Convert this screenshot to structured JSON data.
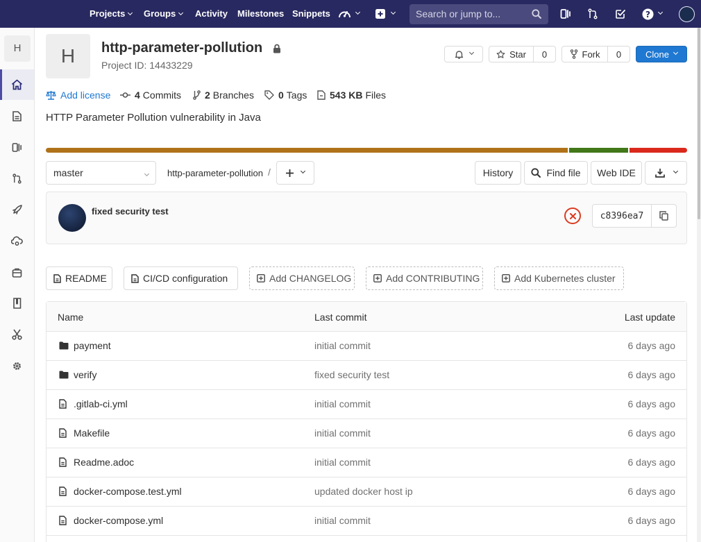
{
  "navbar": {
    "items": [
      {
        "label": "Projects",
        "dropdown": true
      },
      {
        "label": "Groups",
        "dropdown": true
      },
      {
        "label": "Activity",
        "dropdown": false
      },
      {
        "label": "Milestones",
        "dropdown": false
      },
      {
        "label": "Snippets",
        "dropdown": false
      }
    ],
    "search_placeholder": "Search or jump to...",
    "icons": [
      "admin-area-icon",
      "plus-icon",
      "search-icon",
      "issues-icon",
      "merge-requests-icon",
      "todos-icon",
      "help-icon",
      "user-avatar"
    ]
  },
  "sidebar": {
    "project_letter": "H",
    "items": [
      "home-icon",
      "repository-icon",
      "issues-icon",
      "merge-requests-icon",
      "ci-cd-icon",
      "operations-icon",
      "packages-icon",
      "wiki-icon",
      "snippets-icon",
      "settings-icon"
    ],
    "active_index": 0
  },
  "project": {
    "avatar_letter": "H",
    "name": "http-parameter-pollution",
    "id_text": "Project ID: 14433229",
    "description": "HTTP Parameter Pollution vulnerability in Java",
    "visibility": "private"
  },
  "actions": {
    "star_label": "Star",
    "star_count": "0",
    "fork_label": "Fork",
    "fork_count": "0",
    "clone_label": "Clone"
  },
  "stats": {
    "add_license": "Add license",
    "commits_count": "4",
    "commits_label": "Commits",
    "branches_count": "2",
    "branches_label": "Branches",
    "tags_count": "0",
    "tags_label": "Tags",
    "files_size": "543 KB",
    "files_label": "Files"
  },
  "languages": [
    {
      "share": 81.7,
      "color": "#b07219"
    },
    {
      "share": 9.3,
      "color": "#427819"
    },
    {
      "share": 9.0,
      "color": "#da291c"
    }
  ],
  "tree": {
    "branch": "master",
    "breadcrumb": "http-parameter-pollution",
    "separator": "/",
    "history_label": "History",
    "find_file_label": "Find file",
    "web_ide_label": "Web IDE"
  },
  "last_commit": {
    "title": "fixed security test",
    "pipeline_status": "failed",
    "sha": "c8396ea7"
  },
  "shortcuts": [
    {
      "label": "README",
      "style": "solid",
      "icon": "doc-icon"
    },
    {
      "label": "CI/CD configuration",
      "style": "solid",
      "icon": "doc-icon"
    },
    {
      "label": "Add CHANGELOG",
      "style": "dashed",
      "icon": "plus-square-icon"
    },
    {
      "label": "Add CONTRIBUTING",
      "style": "dashed",
      "icon": "plus-square-icon"
    },
    {
      "label": "Add Kubernetes cluster",
      "style": "dashed",
      "icon": "plus-square-icon"
    }
  ],
  "files": {
    "headers": {
      "name": "Name",
      "last_commit": "Last commit",
      "last_update": "Last update"
    },
    "rows": [
      {
        "type": "folder",
        "name": "payment",
        "commit": "initial commit",
        "updated": "6 days ago"
      },
      {
        "type": "folder",
        "name": "verify",
        "commit": "fixed security test",
        "updated": "6 days ago"
      },
      {
        "type": "file",
        "name": ".gitlab-ci.yml",
        "commit": "initial commit",
        "updated": "6 days ago"
      },
      {
        "type": "file",
        "name": "Makefile",
        "commit": "initial commit",
        "updated": "6 days ago"
      },
      {
        "type": "file",
        "name": "Readme.adoc",
        "commit": "initial commit",
        "updated": "6 days ago"
      },
      {
        "type": "file",
        "name": "docker-compose.test.yml",
        "commit": "updated docker host ip",
        "updated": "6 days ago"
      },
      {
        "type": "file",
        "name": "docker-compose.yml",
        "commit": "initial commit",
        "updated": "6 days ago"
      }
    ]
  }
}
